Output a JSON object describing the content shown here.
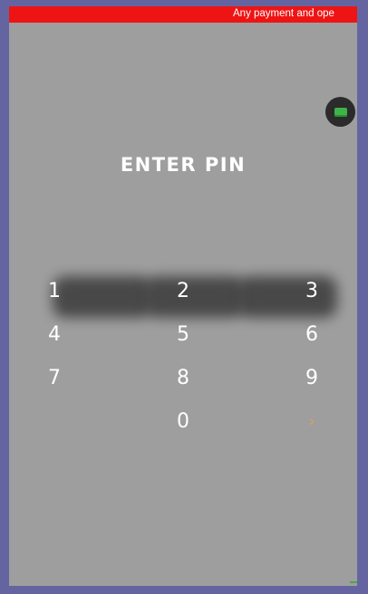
{
  "banner": {
    "text": "Any payment and ope",
    "color": "#ee1414"
  },
  "floating_button": {
    "icon": "green-square-icon"
  },
  "title": "ENTER PIN",
  "keypad": {
    "keys": [
      "1",
      "2",
      "3",
      "4",
      "5",
      "6",
      "7",
      "8",
      "9",
      "0",
      "›"
    ]
  },
  "colors": {
    "background": "#9e9e9e",
    "frame": "#6465a0",
    "enter_key": "#d3a160"
  }
}
